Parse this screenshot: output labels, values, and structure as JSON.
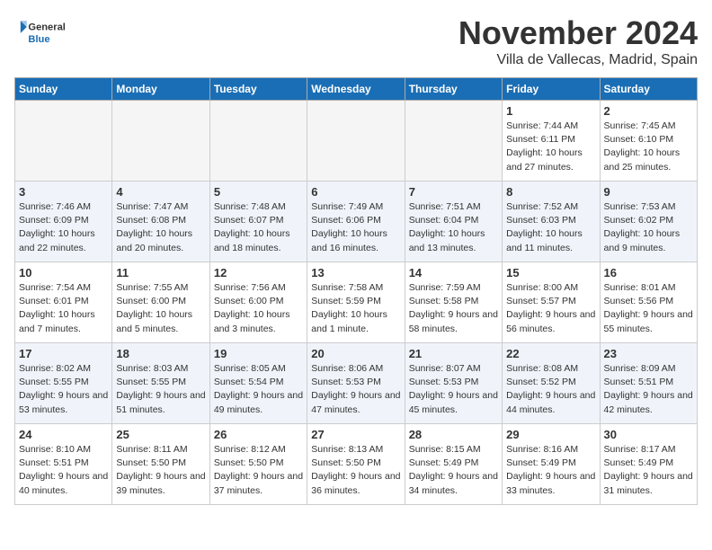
{
  "header": {
    "logo_general": "General",
    "logo_blue": "Blue",
    "month_title": "November 2024",
    "location": "Villa de Vallecas, Madrid, Spain"
  },
  "columns": [
    "Sunday",
    "Monday",
    "Tuesday",
    "Wednesday",
    "Thursday",
    "Friday",
    "Saturday"
  ],
  "weeks": [
    [
      {
        "day": "",
        "info": ""
      },
      {
        "day": "",
        "info": ""
      },
      {
        "day": "",
        "info": ""
      },
      {
        "day": "",
        "info": ""
      },
      {
        "day": "",
        "info": ""
      },
      {
        "day": "1",
        "info": "Sunrise: 7:44 AM\nSunset: 6:11 PM\nDaylight: 10 hours and 27 minutes."
      },
      {
        "day": "2",
        "info": "Sunrise: 7:45 AM\nSunset: 6:10 PM\nDaylight: 10 hours and 25 minutes."
      }
    ],
    [
      {
        "day": "3",
        "info": "Sunrise: 7:46 AM\nSunset: 6:09 PM\nDaylight: 10 hours and 22 minutes."
      },
      {
        "day": "4",
        "info": "Sunrise: 7:47 AM\nSunset: 6:08 PM\nDaylight: 10 hours and 20 minutes."
      },
      {
        "day": "5",
        "info": "Sunrise: 7:48 AM\nSunset: 6:07 PM\nDaylight: 10 hours and 18 minutes."
      },
      {
        "day": "6",
        "info": "Sunrise: 7:49 AM\nSunset: 6:06 PM\nDaylight: 10 hours and 16 minutes."
      },
      {
        "day": "7",
        "info": "Sunrise: 7:51 AM\nSunset: 6:04 PM\nDaylight: 10 hours and 13 minutes."
      },
      {
        "day": "8",
        "info": "Sunrise: 7:52 AM\nSunset: 6:03 PM\nDaylight: 10 hours and 11 minutes."
      },
      {
        "day": "9",
        "info": "Sunrise: 7:53 AM\nSunset: 6:02 PM\nDaylight: 10 hours and 9 minutes."
      }
    ],
    [
      {
        "day": "10",
        "info": "Sunrise: 7:54 AM\nSunset: 6:01 PM\nDaylight: 10 hours and 7 minutes."
      },
      {
        "day": "11",
        "info": "Sunrise: 7:55 AM\nSunset: 6:00 PM\nDaylight: 10 hours and 5 minutes."
      },
      {
        "day": "12",
        "info": "Sunrise: 7:56 AM\nSunset: 6:00 PM\nDaylight: 10 hours and 3 minutes."
      },
      {
        "day": "13",
        "info": "Sunrise: 7:58 AM\nSunset: 5:59 PM\nDaylight: 10 hours and 1 minute."
      },
      {
        "day": "14",
        "info": "Sunrise: 7:59 AM\nSunset: 5:58 PM\nDaylight: 9 hours and 58 minutes."
      },
      {
        "day": "15",
        "info": "Sunrise: 8:00 AM\nSunset: 5:57 PM\nDaylight: 9 hours and 56 minutes."
      },
      {
        "day": "16",
        "info": "Sunrise: 8:01 AM\nSunset: 5:56 PM\nDaylight: 9 hours and 55 minutes."
      }
    ],
    [
      {
        "day": "17",
        "info": "Sunrise: 8:02 AM\nSunset: 5:55 PM\nDaylight: 9 hours and 53 minutes."
      },
      {
        "day": "18",
        "info": "Sunrise: 8:03 AM\nSunset: 5:55 PM\nDaylight: 9 hours and 51 minutes."
      },
      {
        "day": "19",
        "info": "Sunrise: 8:05 AM\nSunset: 5:54 PM\nDaylight: 9 hours and 49 minutes."
      },
      {
        "day": "20",
        "info": "Sunrise: 8:06 AM\nSunset: 5:53 PM\nDaylight: 9 hours and 47 minutes."
      },
      {
        "day": "21",
        "info": "Sunrise: 8:07 AM\nSunset: 5:53 PM\nDaylight: 9 hours and 45 minutes."
      },
      {
        "day": "22",
        "info": "Sunrise: 8:08 AM\nSunset: 5:52 PM\nDaylight: 9 hours and 44 minutes."
      },
      {
        "day": "23",
        "info": "Sunrise: 8:09 AM\nSunset: 5:51 PM\nDaylight: 9 hours and 42 minutes."
      }
    ],
    [
      {
        "day": "24",
        "info": "Sunrise: 8:10 AM\nSunset: 5:51 PM\nDaylight: 9 hours and 40 minutes."
      },
      {
        "day": "25",
        "info": "Sunrise: 8:11 AM\nSunset: 5:50 PM\nDaylight: 9 hours and 39 minutes."
      },
      {
        "day": "26",
        "info": "Sunrise: 8:12 AM\nSunset: 5:50 PM\nDaylight: 9 hours and 37 minutes."
      },
      {
        "day": "27",
        "info": "Sunrise: 8:13 AM\nSunset: 5:50 PM\nDaylight: 9 hours and 36 minutes."
      },
      {
        "day": "28",
        "info": "Sunrise: 8:15 AM\nSunset: 5:49 PM\nDaylight: 9 hours and 34 minutes."
      },
      {
        "day": "29",
        "info": "Sunrise: 8:16 AM\nSunset: 5:49 PM\nDaylight: 9 hours and 33 minutes."
      },
      {
        "day": "30",
        "info": "Sunrise: 8:17 AM\nSunset: 5:49 PM\nDaylight: 9 hours and 31 minutes."
      }
    ]
  ]
}
